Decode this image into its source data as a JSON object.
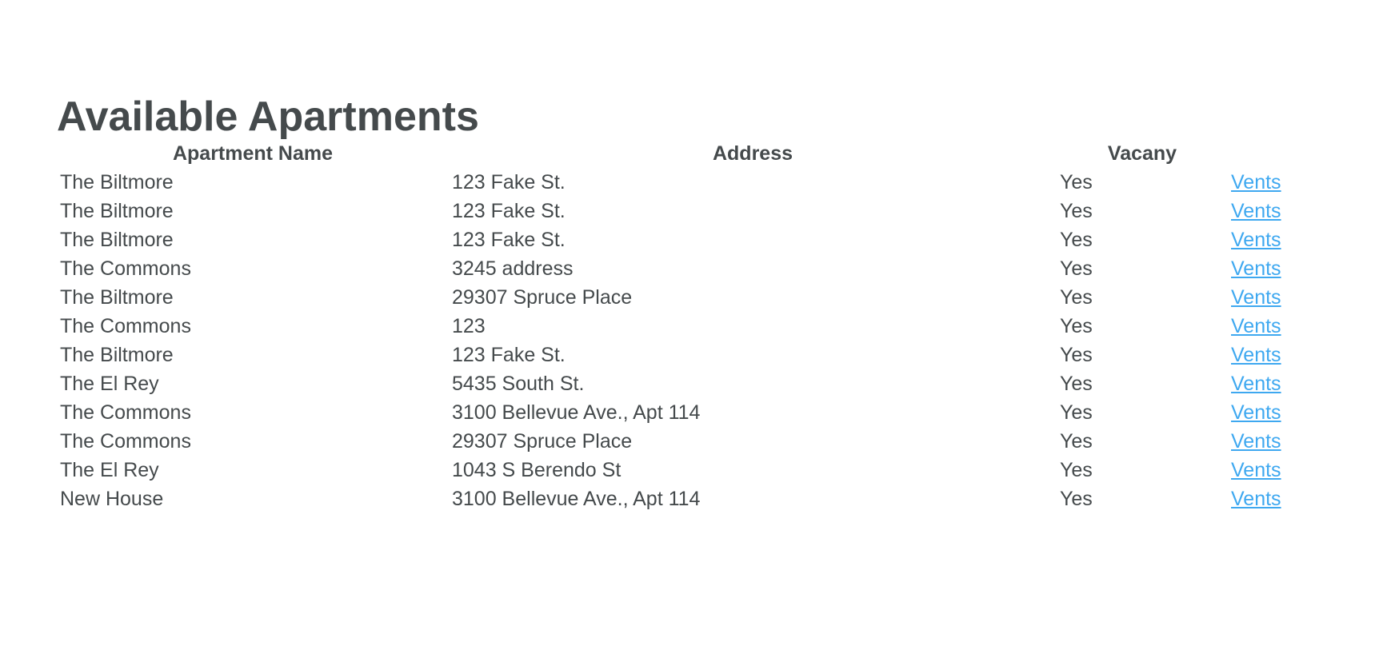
{
  "page": {
    "title": "Available Apartments"
  },
  "table": {
    "headers": {
      "name": "Apartment Name",
      "address": "Address",
      "vacancy": "Vacany",
      "link": ""
    },
    "rows": [
      {
        "name": "The Biltmore",
        "address": "123 Fake St.",
        "vacancy": "Yes",
        "link": "Vents"
      },
      {
        "name": "The Biltmore",
        "address": "123 Fake St.",
        "vacancy": "Yes",
        "link": "Vents"
      },
      {
        "name": "The Biltmore",
        "address": "123 Fake St.",
        "vacancy": "Yes",
        "link": "Vents"
      },
      {
        "name": "The Commons",
        "address": "3245 address",
        "vacancy": "Yes",
        "link": "Vents"
      },
      {
        "name": "The Biltmore",
        "address": "29307 Spruce Place",
        "vacancy": "Yes",
        "link": "Vents"
      },
      {
        "name": "The Commons",
        "address": "123",
        "vacancy": "Yes",
        "link": "Vents"
      },
      {
        "name": "The Biltmore",
        "address": "123 Fake St.",
        "vacancy": "Yes",
        "link": "Vents"
      },
      {
        "name": "The El Rey",
        "address": "5435 South St.",
        "vacancy": "Yes",
        "link": "Vents"
      },
      {
        "name": "The Commons",
        "address": "3100 Bellevue Ave., Apt 114",
        "vacancy": "Yes",
        "link": "Vents"
      },
      {
        "name": "The Commons",
        "address": "29307 Spruce Place",
        "vacancy": "Yes",
        "link": "Vents"
      },
      {
        "name": "The El Rey",
        "address": "1043 S Berendo St",
        "vacancy": "Yes",
        "link": "Vents"
      },
      {
        "name": "New House",
        "address": "3100 Bellevue Ave., Apt 114",
        "vacancy": "Yes",
        "link": "Vents"
      }
    ]
  },
  "colors": {
    "text": "#454a4c",
    "link": "#3ea8f0",
    "background": "#ffffff"
  }
}
